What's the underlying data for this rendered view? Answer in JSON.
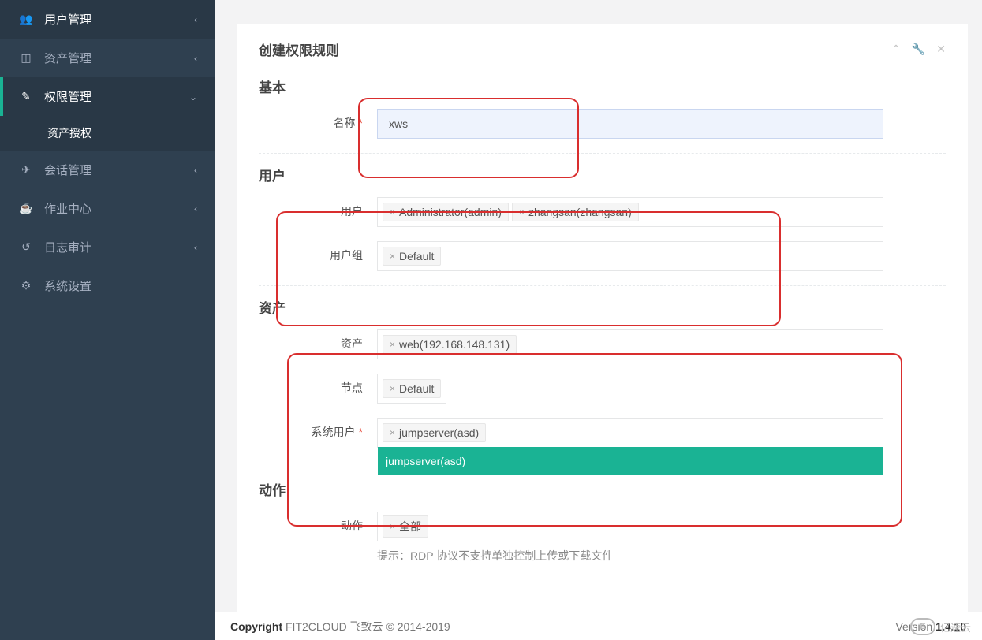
{
  "sidebar": {
    "items": [
      {
        "icon": "users",
        "label": "用户管理",
        "arrow": "‹"
      },
      {
        "icon": "dashboard",
        "label": "资产管理",
        "arrow": "‹"
      },
      {
        "icon": "edit",
        "label": "权限管理",
        "arrow": "⌄",
        "active": true,
        "children": [
          {
            "label": "资产授权"
          }
        ]
      },
      {
        "icon": "rocket",
        "label": "会话管理",
        "arrow": "‹"
      },
      {
        "icon": "coffee",
        "label": "作业中心",
        "arrow": "‹"
      },
      {
        "icon": "history",
        "label": "日志审计",
        "arrow": "‹"
      },
      {
        "icon": "cogs",
        "label": "系统设置",
        "arrow": ""
      }
    ]
  },
  "panel": {
    "title": "创建权限规则"
  },
  "sections": {
    "basic": {
      "title": "基本",
      "name_label": "名称",
      "name_value": "xws"
    },
    "user": {
      "title": "用户",
      "user_label": "用户",
      "users": [
        "Administrator(admin)",
        "zhangsan(zhangsan)"
      ],
      "group_label": "用户组",
      "groups": [
        "Default"
      ]
    },
    "asset": {
      "title": "资产",
      "asset_label": "资产",
      "assets": [
        "web(192.168.148.131)"
      ],
      "node_label": "节点",
      "nodes": [
        "Default"
      ],
      "sysuser_label": "系统用户",
      "sysusers": [
        "jumpserver(asd)"
      ],
      "dropdown_option": "jumpserver(asd)"
    },
    "action": {
      "title": "动作",
      "action_label": "动作",
      "actions": [
        "全部"
      ],
      "hint": "提示：RDP 协议不支持单独控制上传或下载文件"
    }
  },
  "footer": {
    "copyright_bold": "Copyright",
    "copyright_rest": " FIT2CLOUD 飞致云 © 2014-2019",
    "version_label": "Version ",
    "version_value": "1.4.10"
  },
  "watermark": "亿速云"
}
